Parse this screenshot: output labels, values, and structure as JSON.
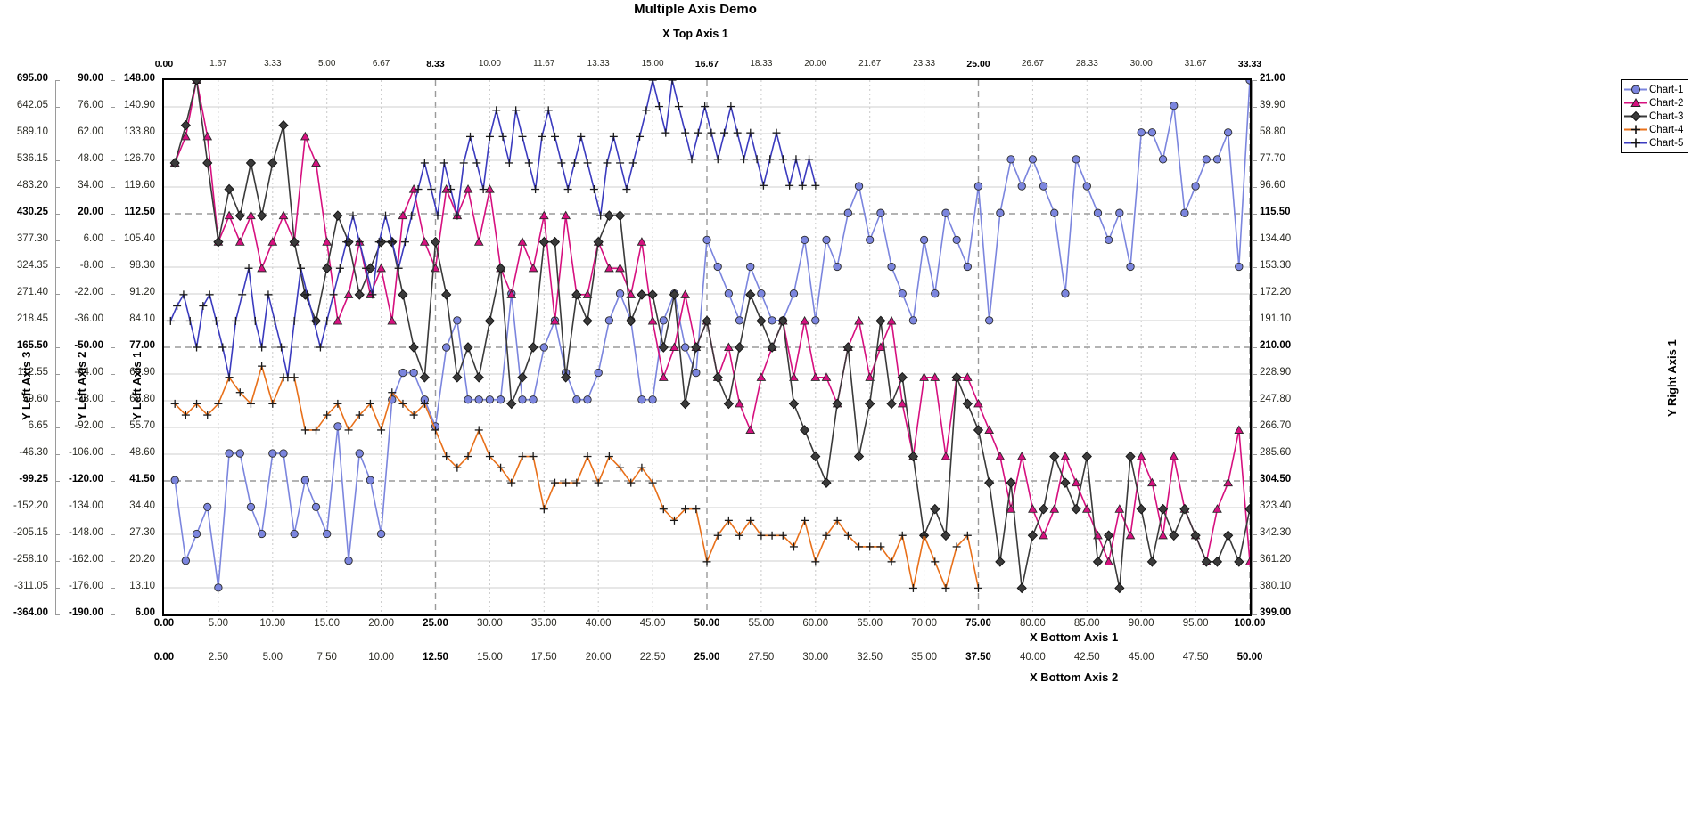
{
  "title": "Multiple Axis Demo",
  "axes": {
    "x_top_1": {
      "name": "X Top Axis 1",
      "ticks": [
        "0.00",
        "1.67",
        "3.33",
        "5.00",
        "6.67",
        "8.33",
        "10.00",
        "11.67",
        "13.33",
        "15.00",
        "16.67",
        "18.33",
        "20.00",
        "21.67",
        "23.33",
        "25.00",
        "26.67",
        "28.33",
        "30.00",
        "31.67",
        "33.33"
      ],
      "major": [
        0,
        5,
        10,
        15,
        20
      ],
      "min": 0,
      "max": 33.33
    },
    "x_bottom_1": {
      "name": "X Bottom Axis 1",
      "ticks": [
        "0.00",
        "5.00",
        "10.00",
        "15.00",
        "20.00",
        "25.00",
        "30.00",
        "35.00",
        "40.00",
        "45.00",
        "50.00",
        "55.00",
        "60.00",
        "65.00",
        "70.00",
        "75.00",
        "80.00",
        "85.00",
        "90.00",
        "95.00",
        "100.00"
      ],
      "major": [
        0,
        5,
        10,
        15,
        20
      ],
      "min": 0,
      "max": 100
    },
    "x_bottom_2": {
      "name": "X Bottom Axis 2",
      "ticks": [
        "0.00",
        "2.50",
        "5.00",
        "7.50",
        "10.00",
        "12.50",
        "15.00",
        "17.50",
        "20.00",
        "22.50",
        "25.00",
        "27.50",
        "30.00",
        "32.50",
        "35.00",
        "37.50",
        "40.00",
        "42.50",
        "45.00",
        "47.50",
        "50.00"
      ],
      "major": [
        0,
        5,
        10,
        15,
        20
      ],
      "min": 0,
      "max": 50
    },
    "y_left_1": {
      "name": "Y Left Axis 1",
      "ticks": [
        "148.00",
        "140.90",
        "133.80",
        "126.70",
        "119.60",
        "112.50",
        "105.40",
        "98.30",
        "91.20",
        "84.10",
        "77.00",
        "69.90",
        "62.80",
        "55.70",
        "48.60",
        "41.50",
        "34.40",
        "27.30",
        "20.20",
        "13.10",
        "6.00"
      ],
      "major": [
        0,
        5,
        10,
        15,
        20
      ],
      "min": 6.0,
      "max": 148.0
    },
    "y_left_2": {
      "name": "Y Left Axis 2",
      "ticks": [
        "90.00",
        "76.00",
        "62.00",
        "48.00",
        "34.00",
        "20.00",
        "6.00",
        "-8.00",
        "-22.00",
        "-36.00",
        "-50.00",
        "-64.00",
        "-78.00",
        "-92.00",
        "-106.00",
        "-120.00",
        "-134.00",
        "-148.00",
        "-162.00",
        "-176.00",
        "-190.00"
      ],
      "major": [
        0,
        5,
        10,
        15,
        20
      ],
      "min": -190.0,
      "max": 90.0
    },
    "y_left_3": {
      "name": "Y Left Axis 3",
      "ticks": [
        "695.00",
        "642.05",
        "589.10",
        "536.15",
        "483.20",
        "430.25",
        "377.30",
        "324.35",
        "271.40",
        "218.45",
        "165.50",
        "112.55",
        "59.60",
        "6.65",
        "-46.30",
        "-99.25",
        "-152.20",
        "-205.15",
        "-258.10",
        "-311.05",
        "-364.00"
      ],
      "major": [
        0,
        5,
        10,
        15,
        20
      ],
      "min": -364.0,
      "max": 695.0
    },
    "y_right_1": {
      "name": "Y Right Axis 1",
      "ticks": [
        "21.00",
        "39.90",
        "58.80",
        "77.70",
        "96.60",
        "115.50",
        "134.40",
        "153.30",
        "172.20",
        "191.10",
        "210.00",
        "228.90",
        "247.80",
        "266.70",
        "285.60",
        "304.50",
        "323.40",
        "342.30",
        "361.20",
        "380.10",
        "399.00"
      ],
      "major": [
        0,
        5,
        10,
        15,
        20
      ],
      "min": 21.0,
      "max": 399.0,
      "inverted": true
    }
  },
  "legend": {
    "items": [
      {
        "label": "Chart-1",
        "color": "#7b85de",
        "marker": "circle"
      },
      {
        "label": "Chart-2",
        "color": "#d6107f",
        "marker": "triangle"
      },
      {
        "label": "Chart-3",
        "color": "#3a3a3a",
        "marker": "diamond"
      },
      {
        "label": "Chart-4",
        "color": "#e8701a",
        "marker": "plus"
      },
      {
        "label": "Chart-5",
        "color": "#3b3bbf",
        "marker": "plus"
      }
    ]
  },
  "chart_data": {
    "type": "line",
    "title": "Multiple Axis Demo",
    "xlabel": "X Bottom Axis 1",
    "ylabel": "Y Left Axis 1",
    "grid": true,
    "legend_position": "right",
    "series": [
      {
        "name": "Chart-1",
        "color": "#7b85de",
        "marker": "circle",
        "x_axis": "x_bottom_1",
        "y_axis": "y_right_1",
        "y_range": [
          21.0,
          399.0
        ],
        "x": [
          1,
          2,
          3,
          4,
          5,
          6,
          7,
          8,
          9,
          10,
          11,
          12,
          13,
          14,
          15,
          16,
          17,
          18,
          19,
          20,
          21,
          22,
          23,
          24,
          25,
          26,
          27,
          28,
          29,
          30,
          31,
          32,
          33,
          34,
          35,
          36,
          37,
          38,
          39,
          40,
          41,
          42,
          43,
          44,
          45,
          46,
          47,
          48,
          49,
          50,
          51,
          52,
          53,
          54,
          55,
          56,
          57,
          58,
          59,
          60,
          61,
          62,
          63,
          64,
          65,
          66,
          67,
          68,
          69,
          70,
          71,
          72,
          73,
          74,
          75,
          76,
          77,
          78,
          79,
          80,
          81,
          82,
          83,
          84,
          85,
          86,
          87,
          88,
          89,
          90,
          91,
          92,
          93,
          94,
          95,
          96,
          97,
          98,
          99,
          100
        ],
        "values": [
          304,
          361,
          342,
          323,
          380,
          285,
          285,
          323,
          342,
          285,
          285,
          342,
          304,
          323,
          342,
          266,
          361,
          285,
          304,
          342,
          247,
          228,
          228,
          247,
          266,
          210,
          191,
          247,
          247,
          247,
          247,
          172,
          247,
          247,
          210,
          191,
          228,
          247,
          247,
          228,
          191,
          172,
          191,
          247,
          247,
          191,
          172,
          210,
          228,
          134,
          153,
          172,
          191,
          153,
          172,
          191,
          191,
          172,
          134,
          191,
          134,
          153,
          115,
          96,
          134,
          115,
          153,
          172,
          191,
          134,
          172,
          115,
          134,
          153,
          96,
          191,
          115,
          77,
          96,
          77,
          96,
          115,
          172,
          77,
          96,
          115,
          134,
          115,
          153,
          58,
          58,
          77,
          39,
          115,
          96,
          77,
          77,
          58,
          153,
          21
        ]
      },
      {
        "name": "Chart-2",
        "color": "#d6107f",
        "marker": "triangle",
        "x_axis": "x_bottom_1",
        "y_axis": "y_left_1",
        "y_range": [
          6.0,
          148.0
        ],
        "x": [
          1,
          2,
          3,
          4,
          5,
          6,
          7,
          8,
          9,
          10,
          11,
          12,
          13,
          14,
          15,
          16,
          17,
          18,
          19,
          20,
          21,
          22,
          23,
          24,
          25,
          26,
          27,
          28,
          29,
          30,
          31,
          32,
          33,
          34,
          35,
          36,
          37,
          38,
          39,
          40,
          41,
          42,
          43,
          44,
          45,
          46,
          47,
          48,
          49,
          50,
          51,
          52,
          53,
          54,
          55,
          56,
          57,
          58,
          59,
          60,
          61,
          62,
          63,
          64,
          65,
          66,
          67,
          68,
          69,
          70,
          71,
          72,
          73,
          74,
          75,
          76,
          77,
          78,
          79,
          80,
          81,
          82,
          83,
          84,
          85,
          86,
          87,
          88,
          89,
          90,
          91,
          92,
          93,
          94,
          95,
          96,
          97,
          98,
          99,
          100
        ],
        "values": [
          126,
          133,
          148,
          133,
          105,
          112,
          105,
          112,
          98,
          105,
          112,
          105,
          133,
          126,
          105,
          84,
          91,
          105,
          91,
          98,
          84,
          112,
          119,
          105,
          98,
          119,
          112,
          119,
          105,
          119,
          98,
          91,
          105,
          98,
          112,
          84,
          112,
          91,
          91,
          105,
          98,
          98,
          91,
          105,
          84,
          69,
          77,
          91,
          77,
          84,
          69,
          77,
          62,
          55,
          69,
          77,
          84,
          69,
          84,
          69,
          69,
          62,
          77,
          84,
          69,
          77,
          84,
          62,
          48,
          69,
          69,
          48,
          69,
          69,
          62,
          55,
          48,
          34,
          48,
          34,
          27,
          34,
          48,
          41,
          34,
          27,
          20,
          34,
          27,
          48,
          41,
          27,
          48,
          34,
          27,
          20,
          34,
          41,
          55,
          20
        ]
      },
      {
        "name": "Chart-3",
        "color": "#3a3a3a",
        "marker": "diamond",
        "x_axis": "x_bottom_1",
        "y_axis": "y_left_1",
        "y_range": [
          6.0,
          148.0
        ],
        "x": [
          1,
          2,
          3,
          4,
          5,
          6,
          7,
          8,
          9,
          10,
          11,
          12,
          13,
          14,
          15,
          16,
          17,
          18,
          19,
          20,
          21,
          22,
          23,
          24,
          25,
          26,
          27,
          28,
          29,
          30,
          31,
          32,
          33,
          34,
          35,
          36,
          37,
          38,
          39,
          40,
          41,
          42,
          43,
          44,
          45,
          46,
          47,
          48,
          49,
          50,
          51,
          52,
          53,
          54,
          55,
          56,
          57,
          58,
          59,
          60,
          61,
          62,
          63,
          64,
          65,
          66,
          67,
          68,
          69,
          70,
          71,
          72,
          73,
          74,
          75,
          76,
          77,
          78,
          79,
          80,
          81,
          82,
          83,
          84,
          85,
          86,
          87,
          88,
          89,
          90,
          91,
          92,
          93,
          94,
          95,
          96,
          97,
          98,
          99,
          100
        ],
        "values": [
          126,
          136,
          148,
          126,
          105,
          119,
          112,
          126,
          112,
          126,
          136,
          105,
          91,
          84,
          98,
          112,
          105,
          91,
          98,
          105,
          105,
          91,
          77,
          69,
          105,
          91,
          69,
          77,
          69,
          84,
          98,
          62,
          69,
          77,
          105,
          105,
          69,
          91,
          84,
          105,
          112,
          112,
          84,
          91,
          91,
          77,
          91,
          62,
          77,
          84,
          69,
          62,
          77,
          91,
          84,
          77,
          84,
          62,
          55,
          48,
          41,
          62,
          77,
          48,
          62,
          84,
          62,
          69,
          48,
          27,
          34,
          27,
          69,
          62,
          55,
          41,
          20,
          41,
          13,
          27,
          34,
          48,
          41,
          34,
          48,
          20,
          27,
          13,
          48,
          34,
          20,
          34,
          27,
          34,
          27,
          20,
          20,
          27,
          20,
          34
        ]
      },
      {
        "name": "Chart-4",
        "color": "#e8701a",
        "marker": "plus",
        "x_axis": "x_bottom_1",
        "y_axis": "y_left_1",
        "y_range": [
          6.0,
          148.0
        ],
        "x": [
          1,
          2,
          3,
          4,
          5,
          6,
          7,
          8,
          9,
          10,
          11,
          12,
          13,
          14,
          15,
          16,
          17,
          18,
          19,
          20,
          21,
          22,
          23,
          24,
          25,
          26,
          27,
          28,
          29,
          30,
          31,
          32,
          33,
          34,
          35,
          36,
          37,
          38,
          39,
          40,
          41,
          42,
          43,
          44,
          45,
          46,
          47,
          48,
          49,
          50,
          51,
          52,
          53,
          54,
          55,
          56,
          57,
          58,
          59,
          60,
          61,
          62,
          63,
          64,
          65,
          66,
          67,
          68,
          69,
          70,
          71,
          72,
          73,
          74,
          75
        ],
        "values": [
          62,
          59,
          62,
          59,
          62,
          69,
          65,
          62,
          72,
          62,
          69,
          69,
          55,
          55,
          59,
          62,
          55,
          59,
          62,
          55,
          65,
          62,
          59,
          62,
          55,
          48,
          45,
          48,
          55,
          48,
          45,
          41,
          48,
          48,
          34,
          41,
          41,
          41,
          48,
          41,
          48,
          45,
          41,
          45,
          41,
          34,
          31,
          34,
          34,
          20,
          27,
          31,
          27,
          31,
          27,
          27,
          27,
          24,
          31,
          20,
          27,
          31,
          27,
          24,
          24,
          24,
          20,
          27,
          13,
          27,
          20,
          13,
          24,
          27,
          13
        ]
      },
      {
        "name": "Chart-5",
        "color": "#3b3bbf",
        "marker": "plus",
        "x_axis": "x_top_1",
        "y_axis": "y_left_1",
        "y_range": [
          6.0,
          148.0
        ],
        "x": [
          0.2,
          0.4,
          0.6,
          0.8,
          1.0,
          1.2,
          1.4,
          1.6,
          1.8,
          2.0,
          2.2,
          2.4,
          2.6,
          2.8,
          3.0,
          3.2,
          3.4,
          3.6,
          3.8,
          4.0,
          4.2,
          4.4,
          4.6,
          4.8,
          5.0,
          5.2,
          5.4,
          5.6,
          5.8,
          6.0,
          6.2,
          6.4,
          6.6,
          6.8,
          7.0,
          7.2,
          7.4,
          7.6,
          7.8,
          8.0,
          8.2,
          8.4,
          8.6,
          8.8,
          9.0,
          9.2,
          9.4,
          9.6,
          9.8,
          10.0,
          10.2,
          10.4,
          10.6,
          10.8,
          11.0,
          11.2,
          11.4,
          11.6,
          11.8,
          12.0,
          12.2,
          12.4,
          12.6,
          12.8,
          13.0,
          13.2,
          13.4,
          13.6,
          13.8,
          14.0,
          14.2,
          14.4,
          14.6,
          14.8,
          15.0,
          15.2,
          15.4,
          15.6,
          15.8,
          16.0,
          16.2,
          16.4,
          16.6,
          16.8,
          17.0,
          17.2,
          17.4,
          17.6,
          17.8,
          18.0,
          18.2,
          18.4,
          18.6,
          18.8,
          19.0,
          19.2,
          19.4,
          19.6,
          19.8,
          20.0
        ],
        "values": [
          84,
          88,
          91,
          84,
          77,
          88,
          91,
          84,
          77,
          69,
          84,
          91,
          98,
          84,
          77,
          91,
          84,
          77,
          69,
          84,
          98,
          91,
          84,
          77,
          84,
          91,
          98,
          105,
          112,
          105,
          98,
          91,
          105,
          112,
          105,
          98,
          105,
          112,
          119,
          126,
          119,
          112,
          126,
          119,
          112,
          126,
          133,
          126,
          119,
          133,
          140,
          133,
          126,
          140,
          133,
          126,
          119,
          133,
          140,
          133,
          126,
          119,
          126,
          133,
          126,
          119,
          112,
          126,
          133,
          126,
          119,
          126,
          133,
          140,
          148,
          141,
          134,
          148,
          141,
          134,
          127,
          134,
          141,
          134,
          127,
          134,
          141,
          134,
          127,
          134,
          127,
          120,
          127,
          134,
          127,
          120,
          127,
          120,
          127,
          120
        ]
      }
    ]
  }
}
